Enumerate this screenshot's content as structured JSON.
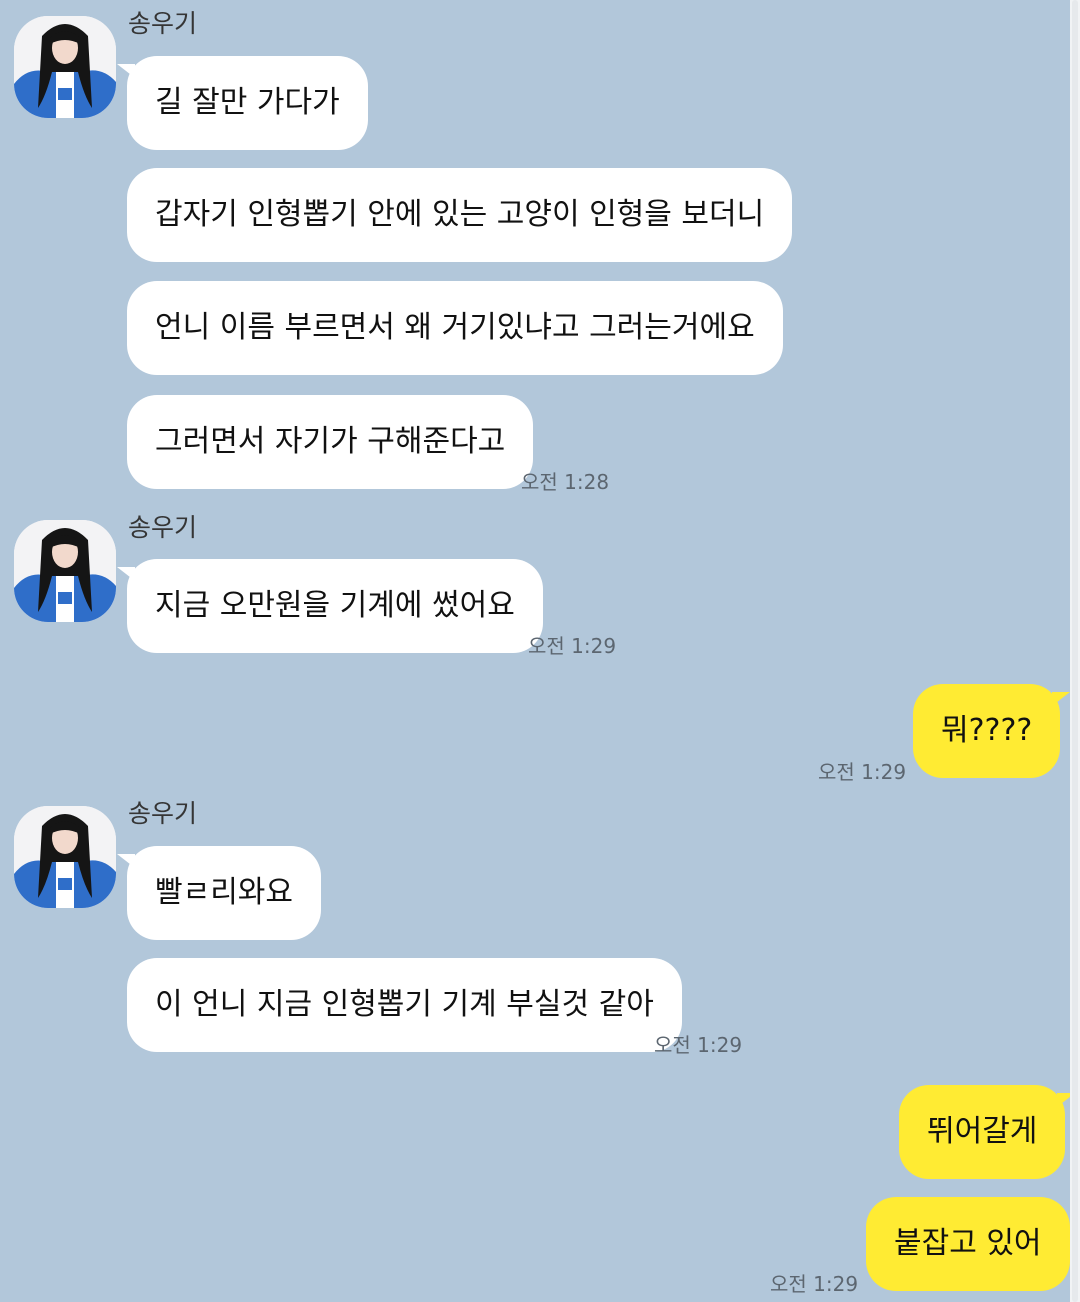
{
  "chat": {
    "groups": [
      {
        "sender": "송우기",
        "messages": [
          {
            "text": "길 잘만 가다가"
          },
          {
            "text": "갑자기 인형뽑기 안에 있는 고양이 인형을 보더니"
          },
          {
            "text": "언니 이름 부르면서 왜 거기있냐고 그러는거에요"
          },
          {
            "text": "그러면서 자기가 구해준다고"
          }
        ],
        "time": "오전 1:28"
      },
      {
        "sender": "송우기",
        "messages": [
          {
            "text": "지금 오만원을 기계에 썼어요"
          }
        ],
        "time": "오전 1:29"
      },
      {
        "sender": "me",
        "messages": [
          {
            "text": "뭐????"
          }
        ],
        "time": "오전 1:29"
      },
      {
        "sender": "송우기",
        "messages": [
          {
            "text": "빨ㄹ리와요"
          },
          {
            "text": "이 언니 지금 인형뽑기 기계 부실것 같아"
          }
        ],
        "time": "오전 1:29"
      },
      {
        "sender": "me",
        "messages": [
          {
            "text": "뛰어갈게"
          },
          {
            "text": "붙잡고 있어"
          }
        ],
        "time": "오전 1:29"
      }
    ]
  },
  "colors": {
    "background": "#b2c7da",
    "incoming_bubble": "#ffffff",
    "outgoing_bubble": "#ffeb33"
  },
  "icons": {
    "avatar": "profile-photo"
  }
}
